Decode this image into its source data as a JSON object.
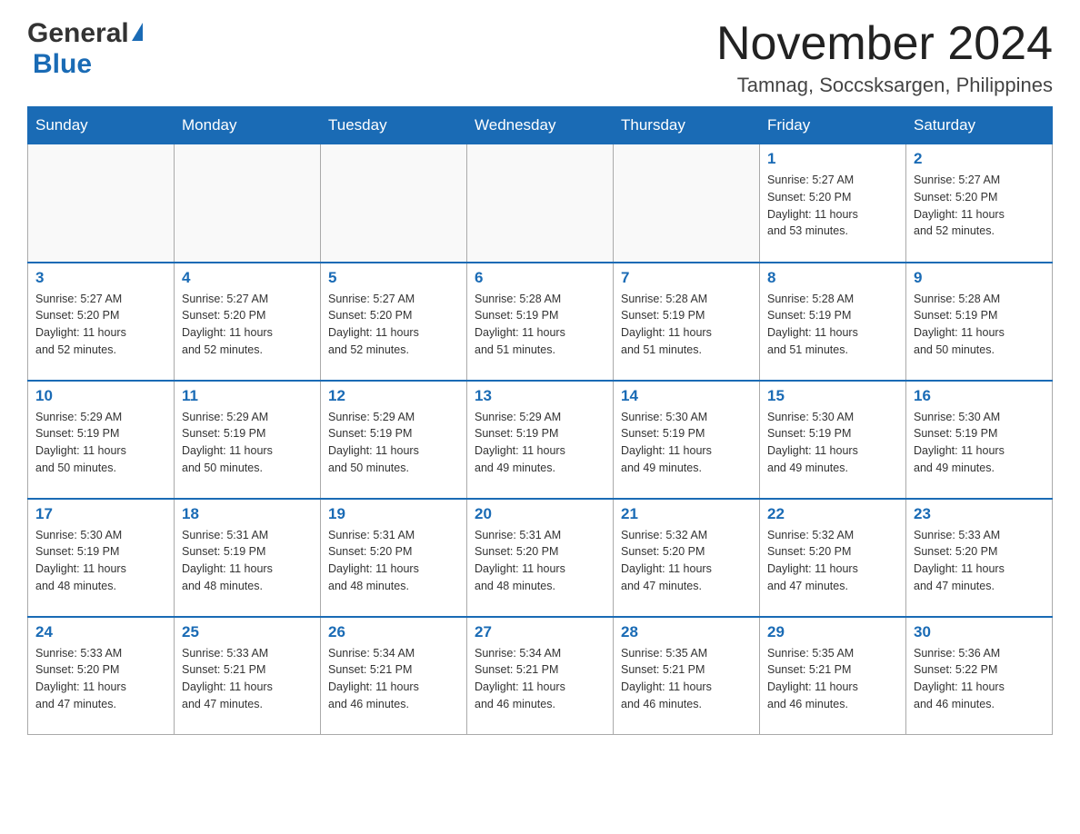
{
  "header": {
    "logo": {
      "general_text": "General",
      "blue_text": "Blue"
    },
    "title": "November 2024",
    "location": "Tamnag, Soccsksargen, Philippines"
  },
  "days_of_week": [
    "Sunday",
    "Monday",
    "Tuesday",
    "Wednesday",
    "Thursday",
    "Friday",
    "Saturday"
  ],
  "weeks": [
    {
      "days": [
        {
          "num": "",
          "info": ""
        },
        {
          "num": "",
          "info": ""
        },
        {
          "num": "",
          "info": ""
        },
        {
          "num": "",
          "info": ""
        },
        {
          "num": "",
          "info": ""
        },
        {
          "num": "1",
          "info": "Sunrise: 5:27 AM\nSunset: 5:20 PM\nDaylight: 11 hours\nand 53 minutes."
        },
        {
          "num": "2",
          "info": "Sunrise: 5:27 AM\nSunset: 5:20 PM\nDaylight: 11 hours\nand 52 minutes."
        }
      ]
    },
    {
      "days": [
        {
          "num": "3",
          "info": "Sunrise: 5:27 AM\nSunset: 5:20 PM\nDaylight: 11 hours\nand 52 minutes."
        },
        {
          "num": "4",
          "info": "Sunrise: 5:27 AM\nSunset: 5:20 PM\nDaylight: 11 hours\nand 52 minutes."
        },
        {
          "num": "5",
          "info": "Sunrise: 5:27 AM\nSunset: 5:20 PM\nDaylight: 11 hours\nand 52 minutes."
        },
        {
          "num": "6",
          "info": "Sunrise: 5:28 AM\nSunset: 5:19 PM\nDaylight: 11 hours\nand 51 minutes."
        },
        {
          "num": "7",
          "info": "Sunrise: 5:28 AM\nSunset: 5:19 PM\nDaylight: 11 hours\nand 51 minutes."
        },
        {
          "num": "8",
          "info": "Sunrise: 5:28 AM\nSunset: 5:19 PM\nDaylight: 11 hours\nand 51 minutes."
        },
        {
          "num": "9",
          "info": "Sunrise: 5:28 AM\nSunset: 5:19 PM\nDaylight: 11 hours\nand 50 minutes."
        }
      ]
    },
    {
      "days": [
        {
          "num": "10",
          "info": "Sunrise: 5:29 AM\nSunset: 5:19 PM\nDaylight: 11 hours\nand 50 minutes."
        },
        {
          "num": "11",
          "info": "Sunrise: 5:29 AM\nSunset: 5:19 PM\nDaylight: 11 hours\nand 50 minutes."
        },
        {
          "num": "12",
          "info": "Sunrise: 5:29 AM\nSunset: 5:19 PM\nDaylight: 11 hours\nand 50 minutes."
        },
        {
          "num": "13",
          "info": "Sunrise: 5:29 AM\nSunset: 5:19 PM\nDaylight: 11 hours\nand 49 minutes."
        },
        {
          "num": "14",
          "info": "Sunrise: 5:30 AM\nSunset: 5:19 PM\nDaylight: 11 hours\nand 49 minutes."
        },
        {
          "num": "15",
          "info": "Sunrise: 5:30 AM\nSunset: 5:19 PM\nDaylight: 11 hours\nand 49 minutes."
        },
        {
          "num": "16",
          "info": "Sunrise: 5:30 AM\nSunset: 5:19 PM\nDaylight: 11 hours\nand 49 minutes."
        }
      ]
    },
    {
      "days": [
        {
          "num": "17",
          "info": "Sunrise: 5:30 AM\nSunset: 5:19 PM\nDaylight: 11 hours\nand 48 minutes."
        },
        {
          "num": "18",
          "info": "Sunrise: 5:31 AM\nSunset: 5:19 PM\nDaylight: 11 hours\nand 48 minutes."
        },
        {
          "num": "19",
          "info": "Sunrise: 5:31 AM\nSunset: 5:20 PM\nDaylight: 11 hours\nand 48 minutes."
        },
        {
          "num": "20",
          "info": "Sunrise: 5:31 AM\nSunset: 5:20 PM\nDaylight: 11 hours\nand 48 minutes."
        },
        {
          "num": "21",
          "info": "Sunrise: 5:32 AM\nSunset: 5:20 PM\nDaylight: 11 hours\nand 47 minutes."
        },
        {
          "num": "22",
          "info": "Sunrise: 5:32 AM\nSunset: 5:20 PM\nDaylight: 11 hours\nand 47 minutes."
        },
        {
          "num": "23",
          "info": "Sunrise: 5:33 AM\nSunset: 5:20 PM\nDaylight: 11 hours\nand 47 minutes."
        }
      ]
    },
    {
      "days": [
        {
          "num": "24",
          "info": "Sunrise: 5:33 AM\nSunset: 5:20 PM\nDaylight: 11 hours\nand 47 minutes."
        },
        {
          "num": "25",
          "info": "Sunrise: 5:33 AM\nSunset: 5:21 PM\nDaylight: 11 hours\nand 47 minutes."
        },
        {
          "num": "26",
          "info": "Sunrise: 5:34 AM\nSunset: 5:21 PM\nDaylight: 11 hours\nand 46 minutes."
        },
        {
          "num": "27",
          "info": "Sunrise: 5:34 AM\nSunset: 5:21 PM\nDaylight: 11 hours\nand 46 minutes."
        },
        {
          "num": "28",
          "info": "Sunrise: 5:35 AM\nSunset: 5:21 PM\nDaylight: 11 hours\nand 46 minutes."
        },
        {
          "num": "29",
          "info": "Sunrise: 5:35 AM\nSunset: 5:21 PM\nDaylight: 11 hours\nand 46 minutes."
        },
        {
          "num": "30",
          "info": "Sunrise: 5:36 AM\nSunset: 5:22 PM\nDaylight: 11 hours\nand 46 minutes."
        }
      ]
    }
  ]
}
